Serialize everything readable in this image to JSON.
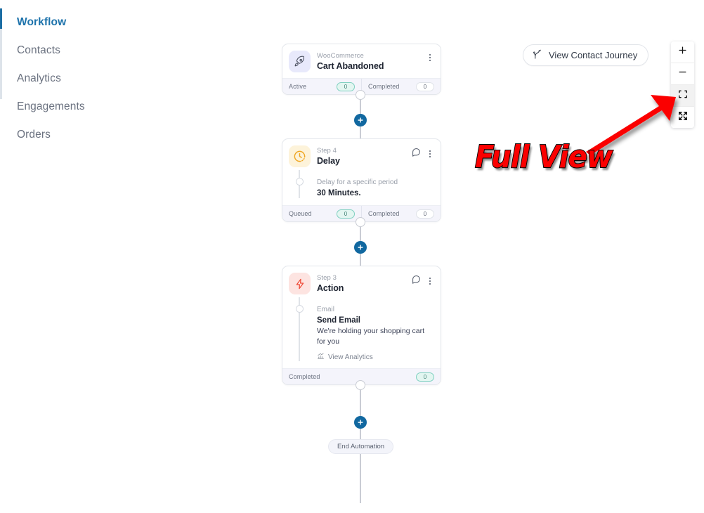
{
  "sidebar": {
    "items": [
      {
        "label": "Workflow",
        "active": true
      },
      {
        "label": "Contacts",
        "active": false
      },
      {
        "label": "Analytics",
        "active": false
      },
      {
        "label": "Engagements",
        "active": false
      },
      {
        "label": "Orders",
        "active": false
      }
    ]
  },
  "header": {
    "title": "Workflow"
  },
  "toolbar": {
    "journey_label": "View Contact Journey",
    "journey_icon": "branch-icon",
    "zoom_in_icon": "plus-icon",
    "zoom_out_icon": "minus-icon",
    "fit_view_icon": "fit-view-icon",
    "full_view_icon": "full-view-icon"
  },
  "annotation": {
    "label": "Full View",
    "color": "#fb0000",
    "arrow_color": "#fb0000"
  },
  "flow": {
    "add_icon": "plus-icon",
    "end_label": "End Automation",
    "nodes": [
      {
        "icon": "rocket-icon",
        "icon_theme": "purple",
        "subtitle": "WooCommerce",
        "title": "Cart Abandoned",
        "has_comment_icon": false,
        "menu_icon": "more-vertical-icon",
        "body": null,
        "footer": [
          {
            "label": "Active",
            "value": "0",
            "style": "teal"
          },
          {
            "label": "Completed",
            "value": "0",
            "style": "white"
          }
        ]
      },
      {
        "icon": "clock-icon",
        "icon_theme": "amber",
        "subtitle": "Step 4",
        "title": "Delay",
        "has_comment_icon": true,
        "comment_icon": "comment-icon",
        "menu_icon": "more-vertical-icon",
        "body": {
          "label": "Delay for a specific period",
          "strong": "30 Minutes.",
          "text": null,
          "analytics_label": null
        },
        "footer": [
          {
            "label": "Queued",
            "value": "0",
            "style": "teal"
          },
          {
            "label": "Completed",
            "value": "0",
            "style": "white"
          }
        ]
      },
      {
        "icon": "lightning-icon",
        "icon_theme": "rose",
        "subtitle": "Step 3",
        "title": "Action",
        "has_comment_icon": true,
        "comment_icon": "comment-icon",
        "menu_icon": "more-vertical-icon",
        "body": {
          "label": "Email",
          "strong": "Send Email",
          "text": "We're holding your shopping cart for you",
          "analytics_label": "View Analytics",
          "analytics_icon": "bar-chart-icon"
        },
        "footer": [
          {
            "label": "Completed",
            "value": "0",
            "style": "teal"
          }
        ]
      }
    ]
  }
}
